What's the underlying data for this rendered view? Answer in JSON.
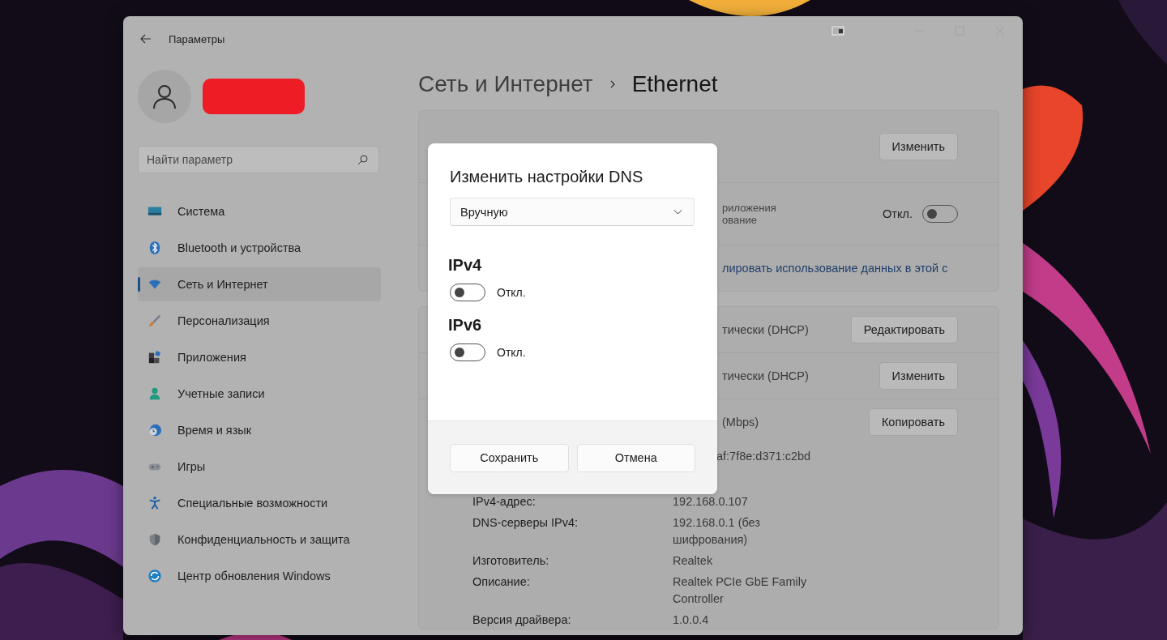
{
  "window": {
    "title": "Параметры"
  },
  "sidebar": {
    "search": {
      "placeholder": "Найти параметр"
    },
    "items": [
      {
        "label": "Система",
        "selected": false
      },
      {
        "label": "Bluetooth и устройства",
        "selected": false
      },
      {
        "label": "Сеть и Интернет",
        "selected": true
      },
      {
        "label": "Персонализация",
        "selected": false
      },
      {
        "label": "Приложения",
        "selected": false
      },
      {
        "label": "Учетные записи",
        "selected": false
      },
      {
        "label": "Время и язык",
        "selected": false
      },
      {
        "label": "Игры",
        "selected": false
      },
      {
        "label": "Специальные возможности",
        "selected": false
      },
      {
        "label": "Конфиденциальность и защита",
        "selected": false
      },
      {
        "label": "Центр обновления Windows",
        "selected": false
      }
    ]
  },
  "breadcrumb": {
    "parent": "Сеть и Интернет",
    "current": "Ethernet"
  },
  "settings_rows": [
    {
      "kind": "button",
      "button": "Изменить"
    },
    {
      "kind": "toggle",
      "text": [
        "риложения",
        "ование"
      ],
      "state_label": "Откл.",
      "on": false
    },
    {
      "kind": "link",
      "link": "лировать использование данных в этой с"
    },
    {
      "kind": "button",
      "text": [
        "тически (DHCP)"
      ],
      "button": "Редактировать"
    },
    {
      "kind": "button",
      "text": [
        "тически (DHCP)"
      ],
      "button": "Изменить"
    },
    {
      "kind": "button",
      "text": [
        "(Mbps)"
      ],
      "button": "Копировать"
    }
  ],
  "properties": [
    {
      "value": "af:7f8e:d371:c2bd"
    },
    {
      "label": "IPv4-адрес:",
      "value": "192.168.0.107"
    },
    {
      "label": "DNS-серверы IPv4:",
      "value": "192.168.0.1 (без шифрования)"
    },
    {
      "label": "Изготовитель:",
      "value": "Realtek"
    },
    {
      "label": "Описание:",
      "value": "Realtek PCIe GbE Family Controller"
    },
    {
      "label": "Версия драйвера:",
      "value": "1.0.0.4"
    }
  ],
  "dialog": {
    "title": "Изменить настройки DNS",
    "select": {
      "value": "Вручную"
    },
    "sections": [
      {
        "heading": "IPv4",
        "on": false,
        "state_label": "Откл."
      },
      {
        "heading": "IPv6",
        "on": false,
        "state_label": "Откл."
      }
    ],
    "buttons": [
      "Сохранить",
      "Отмена"
    ]
  }
}
